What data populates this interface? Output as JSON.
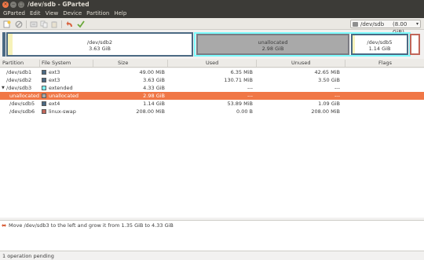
{
  "window": {
    "title": "/dev/sdb - GParted"
  },
  "menu": [
    "GParted",
    "Edit",
    "View",
    "Device",
    "Partition",
    "Help"
  ],
  "toolbar": {
    "icons": [
      "new-icon",
      "delete-icon",
      "resize-move-icon",
      "copy-icon",
      "paste-icon",
      "undo-icon",
      "apply-icon"
    ],
    "device": "/dev/sdb",
    "device_size": "(8.00 GiB)"
  },
  "diskmap": {
    "sdb2": {
      "name": "/dev/sdb2",
      "size": "3.63 GiB"
    },
    "unallocated": {
      "name": "unallocated",
      "size": "2.98 GiB"
    },
    "sdb5": {
      "name": "/dev/sdb5",
      "size": "1.14 GiB"
    }
  },
  "columns": [
    "Partition",
    "File System",
    "Size",
    "Used",
    "Unused",
    "Flags"
  ],
  "rows": [
    {
      "partition": "/dev/sdb1",
      "fs": "ext3",
      "size": "49.00 MiB",
      "used": "6.35 MiB",
      "unused": "42.65 MiB",
      "flags": "",
      "color": "#4b6983"
    },
    {
      "partition": "/dev/sdb2",
      "fs": "ext3",
      "size": "3.63 GiB",
      "used": "130.71 MiB",
      "unused": "3.50 GiB",
      "flags": "",
      "color": "#4b6983"
    },
    {
      "partition": "/dev/sdb3",
      "fs": "extended",
      "size": "4.33 GiB",
      "used": "---",
      "unused": "---",
      "flags": "",
      "color": "#7dfcfe"
    },
    {
      "partition": "unallocated",
      "fs": "unallocated",
      "size": "2.98 GiB",
      "used": "---",
      "unused": "---",
      "flags": "",
      "color": "#a9a9a9"
    },
    {
      "partition": "/dev/sdb5",
      "fs": "ext4",
      "size": "1.14 GiB",
      "used": "53.89 MiB",
      "unused": "1.09 GiB",
      "flags": "",
      "color": "#4b6983"
    },
    {
      "partition": "/dev/sdb6",
      "fs": "linux-swap",
      "size": "208.00 MiB",
      "used": "0.00 B",
      "unused": "208.00 MiB",
      "flags": "",
      "color": "#c1665a"
    }
  ],
  "operations": [
    "Move /dev/sdb3 to the left and grow it from 1.35 GiB to 4.33 GiB"
  ],
  "status": "1 operation pending",
  "colors": {
    "accent": "#f07746",
    "titlebar": "#3c3b37",
    "unallocated": "#a9a9a9",
    "extended": "#7dfcfe"
  }
}
